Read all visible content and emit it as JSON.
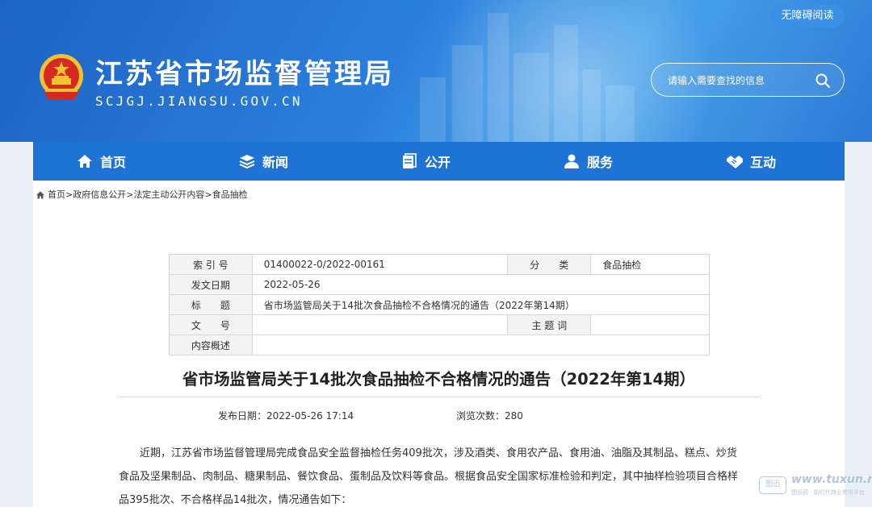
{
  "header": {
    "title": "江苏省市场监督管理局",
    "domain": "SCJGJ.JIANGSU.GOV.CN",
    "accessibility_label": "无障碍阅读",
    "search_placeholder": "请输入需要查找的信息"
  },
  "nav": {
    "items": [
      {
        "label": "首页",
        "icon": "home-icon"
      },
      {
        "label": "新闻",
        "icon": "layers-icon"
      },
      {
        "label": "公开",
        "icon": "document-stack-icon"
      },
      {
        "label": "服务",
        "icon": "user-service-icon"
      },
      {
        "label": "互动",
        "icon": "handshake-icon"
      }
    ]
  },
  "breadcrumb": {
    "items": [
      "首页",
      "政府信息公开",
      "法定主动公开内容",
      "食品抽检"
    ],
    "separator": ">"
  },
  "meta": {
    "index_label": "索 引 号",
    "index_value": "01400022-0/2022-00161",
    "category_label": "分　　类",
    "category_value": "食品抽检",
    "date_label": "发文日期",
    "date_value": "2022-05-26",
    "title_label": "标　　题",
    "title_value": "省市场监管局关于14批次食品抽检不合格情况的通告（2022年第14期）",
    "docno_label": "文　　号",
    "docno_value": "",
    "subject_label": "主 题 词",
    "subject_value": "",
    "summary_label": "内容概述",
    "summary_value": ""
  },
  "article": {
    "title": "省市场监管局关于14批次食品抽检不合格情况的通告（2022年第14期）",
    "publish_label": "发布日期：",
    "publish_time": "2022-05-26 17:14",
    "views_label": "浏览次数：",
    "views_count": "280",
    "paragraph_line1": "近期，江苏省市场监督管理局完成食品安全监督抽检任务409批次，涉及酒类、食用农产品、食用油、油脂及其制品、糕点、炒货",
    "paragraph_line2": "食品及坚果制品、肉制品、糖果制品、餐饮食品、蛋制品及饮料等食品。根据食品安全国家标准检验和判定，其中抽样检验项目合格样",
    "paragraph_line3": "品395批次、不合格样品14批次，情况通告如下："
  },
  "watermark": {
    "badge": "图迅",
    "site": "www.tuxun.net",
    "sub": "图迅网 · 新时代商业资讯平台"
  },
  "colors": {
    "nav_bg": "#1e73d4",
    "banner_primary": "#2b7fdc",
    "page_bg": "#eaf0f7"
  }
}
